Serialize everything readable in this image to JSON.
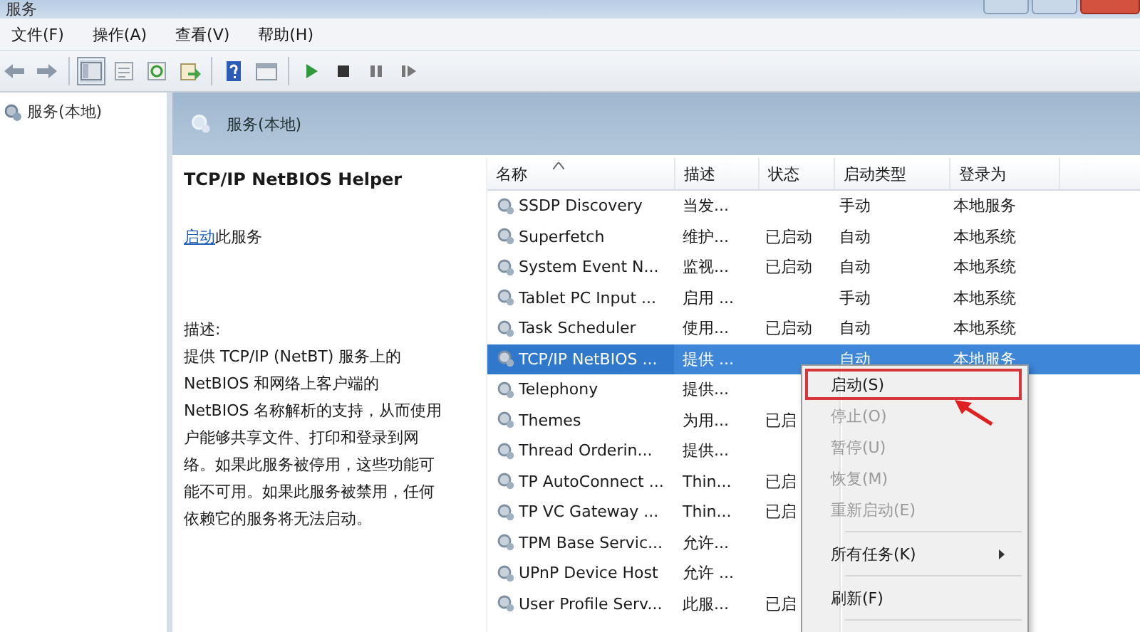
{
  "window": {
    "title": "服务"
  },
  "menu_bar": [
    "文件(F)",
    "操作(A)",
    "查看(V)",
    "帮助(H)"
  ],
  "tree": {
    "items": [
      {
        "label": "服务(本地)",
        "selected": false
      }
    ]
  },
  "panel_header": {
    "title": "服务(本地)"
  },
  "details": {
    "service_name": "TCP/IP NetBIOS Helper",
    "action_link": "启动",
    "action_rest": "此服务",
    "description_label": "描述:",
    "description_lines": [
      "提供 TCP/IP (NetBT) 服务上的",
      "NetBIOS 和网络上客户端的",
      "NetBIOS 名称解析的支持，从而使用",
      "户能够共享文件、打印和登录到网",
      "络。如果此服务被停用，这些功能可",
      "能不可用。如果此服务被禁用，任何",
      "依赖它的服务将无法启动。"
    ]
  },
  "table": {
    "columns": [
      "名称",
      "描述",
      "状态",
      "启动类型",
      "登录为"
    ],
    "rows": [
      {
        "name": "SSDP Discovery",
        "description": "当发...",
        "status": "",
        "startup": "手动",
        "logon": "本地服务",
        "selected": false
      },
      {
        "name": "Superfetch",
        "description": "维护...",
        "status": "已启动",
        "startup": "自动",
        "logon": "本地系统",
        "selected": false
      },
      {
        "name": "System Event N...",
        "description": "监视...",
        "status": "已启动",
        "startup": "自动",
        "logon": "本地系统",
        "selected": false
      },
      {
        "name": "Tablet PC Input ...",
        "description": "启用 ...",
        "status": "",
        "startup": "手动",
        "logon": "本地系统",
        "selected": false
      },
      {
        "name": "Task Scheduler",
        "description": "使用...",
        "status": "已启动",
        "startup": "自动",
        "logon": "本地系统",
        "selected": false
      },
      {
        "name": "TCP/IP NetBIOS ...",
        "description": "提供 ...",
        "status": "",
        "startup": "自动",
        "logon": "本地服务",
        "selected": true
      },
      {
        "name": "Telephony",
        "description": "提供...",
        "status": "",
        "selected": false
      },
      {
        "name": "Themes",
        "description": "为用...",
        "status": "已启",
        "selected": false
      },
      {
        "name": "Thread Orderin...",
        "description": "提供...",
        "status": "",
        "selected": false
      },
      {
        "name": "TP AutoConnect ...",
        "description": "Thin...",
        "status": "已启",
        "selected": false
      },
      {
        "name": "TP VC Gateway ...",
        "description": "Thin...",
        "status": "已启",
        "selected": false
      },
      {
        "name": "TPM Base Servic...",
        "description": "允许...",
        "status": "",
        "selected": false
      },
      {
        "name": "UPnP Device Host",
        "description": "允许 ...",
        "status": "",
        "selected": false
      },
      {
        "name": "User Profile Serv...",
        "description": "此服...",
        "status": "已启",
        "selected": false
      }
    ]
  },
  "context_menu": {
    "items": [
      {
        "kind": "item",
        "label": "启动(S)",
        "disabled": false,
        "highlighted": true
      },
      {
        "kind": "item",
        "label": "停止(O)",
        "disabled": true,
        "highlighted": false
      },
      {
        "kind": "item",
        "label": "暂停(U)",
        "disabled": true,
        "highlighted": false
      },
      {
        "kind": "item",
        "label": "恢复(M)",
        "disabled": true,
        "highlighted": false
      },
      {
        "kind": "item",
        "label": "重新启动(E)",
        "disabled": true,
        "highlighted": false
      },
      {
        "kind": "separator"
      },
      {
        "kind": "submenu",
        "label": "所有任务(K)",
        "disabled": false,
        "highlighted": false
      },
      {
        "kind": "separator"
      },
      {
        "kind": "item",
        "label": "刷新(F)",
        "disabled": false,
        "highlighted": false
      },
      {
        "kind": "separator"
      }
    ]
  }
}
